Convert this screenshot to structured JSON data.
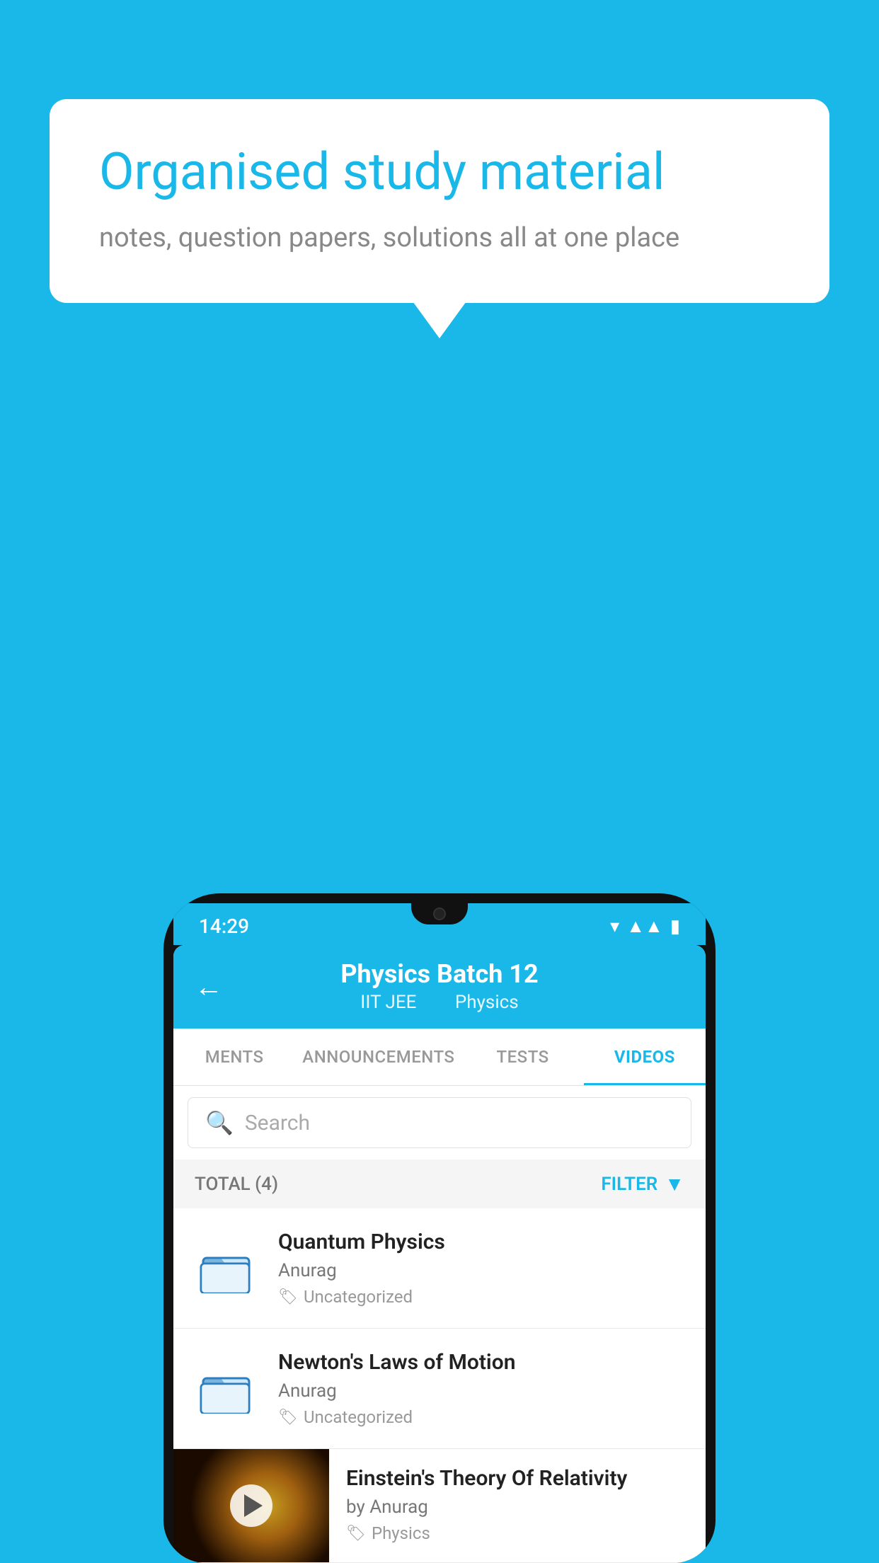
{
  "background": {
    "color": "#1ab8e8"
  },
  "speech_bubble": {
    "title": "Organised study material",
    "subtitle": "notes, question papers, solutions all at one place"
  },
  "phone": {
    "status_bar": {
      "time": "14:29"
    },
    "header": {
      "back_label": "←",
      "title": "Physics Batch 12",
      "subtitle_1": "IIT JEE",
      "subtitle_2": "Physics"
    },
    "tabs": [
      {
        "label": "MENTS",
        "active": false
      },
      {
        "label": "ANNOUNCEMENTS",
        "active": false
      },
      {
        "label": "TESTS",
        "active": false
      },
      {
        "label": "VIDEOS",
        "active": true
      }
    ],
    "search": {
      "placeholder": "Search"
    },
    "filter_bar": {
      "total_label": "TOTAL (4)",
      "filter_label": "FILTER"
    },
    "videos": [
      {
        "id": 1,
        "title": "Quantum Physics",
        "author": "Anurag",
        "tag": "Uncategorized",
        "type": "folder"
      },
      {
        "id": 2,
        "title": "Newton's Laws of Motion",
        "author": "Anurag",
        "tag": "Uncategorized",
        "type": "folder"
      },
      {
        "id": 3,
        "title": "Einstein's Theory Of Relativity",
        "author": "by Anurag",
        "tag": "Physics",
        "type": "video"
      }
    ]
  }
}
